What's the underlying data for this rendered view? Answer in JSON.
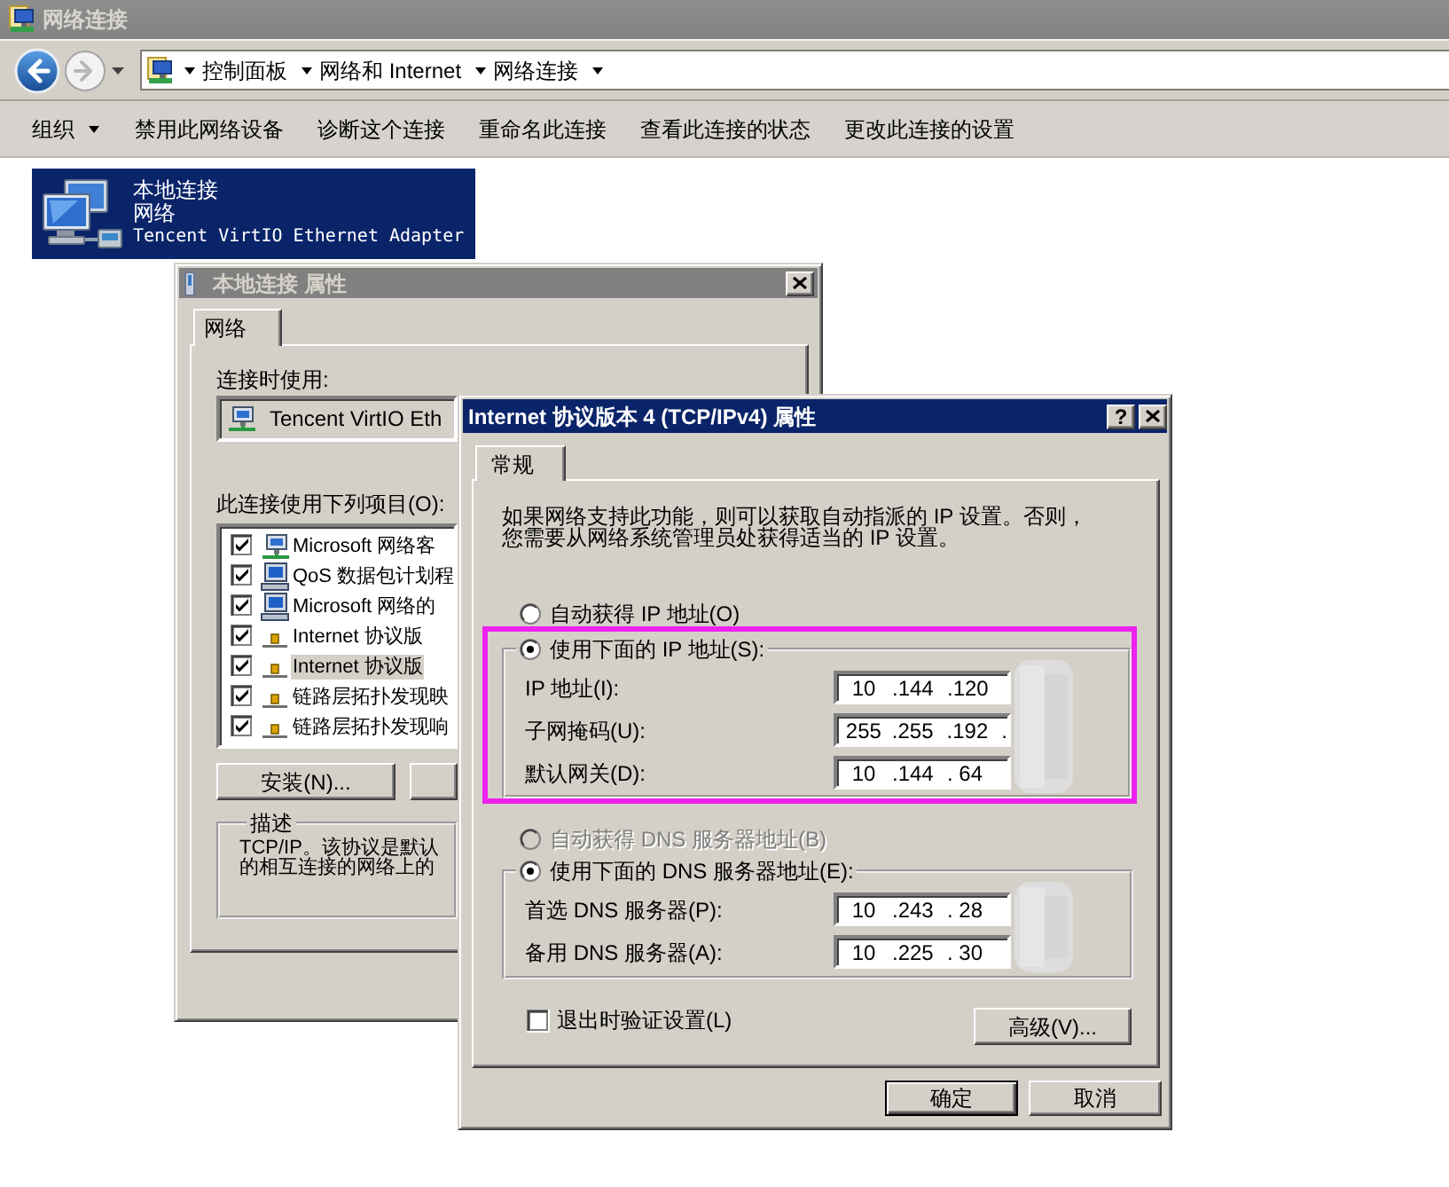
{
  "window": {
    "title": "网络连接",
    "active": false
  },
  "address_bar": {
    "breadcrumbs": [
      "控制面板",
      "网络和 Internet",
      "网络连接"
    ]
  },
  "toolbar": [
    {
      "label": "组织",
      "menu": true
    },
    {
      "label": "禁用此网络设备",
      "menu": false
    },
    {
      "label": "诊断这个连接",
      "menu": false
    },
    {
      "label": "重命名此连接",
      "menu": false
    },
    {
      "label": "查看此连接的状态",
      "menu": false
    },
    {
      "label": "更改此连接的设置",
      "menu": false
    }
  ],
  "connections": [
    {
      "name": "本地连接",
      "status": "网络",
      "adapter": "Tencent VirtIO Ethernet Adapter",
      "selected": true
    }
  ],
  "properties_dialog": {
    "title": "本地连接 属性",
    "active": false,
    "tabs": [
      {
        "label": "网络",
        "selected": true
      }
    ],
    "connect_using_label": "连接时使用:",
    "adapter": "Tencent VirtIO Eth",
    "items_label": "此连接使用下列项目(O):",
    "items": [
      {
        "kind": "client",
        "label": "Microsoft 网络客",
        "checked": true,
        "selected": false
      },
      {
        "kind": "service",
        "label": "QoS 数据包计划程",
        "checked": true,
        "selected": false
      },
      {
        "kind": "service",
        "label": "Microsoft 网络的",
        "checked": true,
        "selected": false
      },
      {
        "kind": "protocol",
        "label": "Internet 协议版",
        "checked": true,
        "selected": false
      },
      {
        "kind": "protocol",
        "label": "Internet 协议版",
        "checked": true,
        "selected": true
      },
      {
        "kind": "protocol",
        "label": "链路层拓扑发现映",
        "checked": true,
        "selected": false
      },
      {
        "kind": "protocol",
        "label": "链路层拓扑发现响",
        "checked": true,
        "selected": false
      }
    ],
    "buttons": [
      "安装(N)..."
    ],
    "description": {
      "title": "描述",
      "text": "TCP/IP。该协议是默认的相互连接的网络上的"
    }
  },
  "ipv4_dialog": {
    "title": "Internet 协议版本 4 (TCP/IPv4) 属性",
    "active": true,
    "help": "?",
    "tabs": [
      {
        "label": "常规",
        "selected": true
      }
    ],
    "intro": "如果网络支持此功能，则可以获取自动指派的 IP 设置。否则，您需要从网络系统管理员处获得适当的 IP 设置。",
    "ip": {
      "options": [
        {
          "label": "自动获得 IP 地址(O)",
          "selected": false,
          "disabled": false
        },
        {
          "label": "使用下面的 IP 地址(S):",
          "selected": true,
          "disabled": false
        }
      ],
      "highlighted": true,
      "redacted": true,
      "fields": [
        {
          "label": "IP 地址(I):",
          "segments": [
            "10",
            ".144",
            ".120"
          ]
        },
        {
          "label": "子网掩码(U):",
          "segments": [
            "255",
            ".255",
            ".192",
            "."
          ]
        },
        {
          "label": "默认网关(D):",
          "segments": [
            "10",
            ".144",
            ". 64"
          ]
        }
      ]
    },
    "dns": {
      "options": [
        {
          "label": "自动获得 DNS 服务器地址(B)",
          "selected": false,
          "disabled": true
        },
        {
          "label": "使用下面的 DNS 服务器地址(E):",
          "selected": true,
          "disabled": false
        }
      ],
      "redacted": true,
      "fields": [
        {
          "label": "首选 DNS 服务器(P):",
          "segments": [
            "10",
            ".243",
            ". 28"
          ]
        },
        {
          "label": "备用 DNS 服务器(A):",
          "segments": [
            "10",
            ".225",
            ". 30"
          ]
        }
      ]
    },
    "validate_on_exit": {
      "label": "退出时验证设置(L)",
      "checked": false
    },
    "advanced_button": "高级(V)...",
    "buttons": [
      {
        "label": "确定",
        "default": true
      },
      {
        "label": "取消",
        "default": false
      }
    ]
  }
}
